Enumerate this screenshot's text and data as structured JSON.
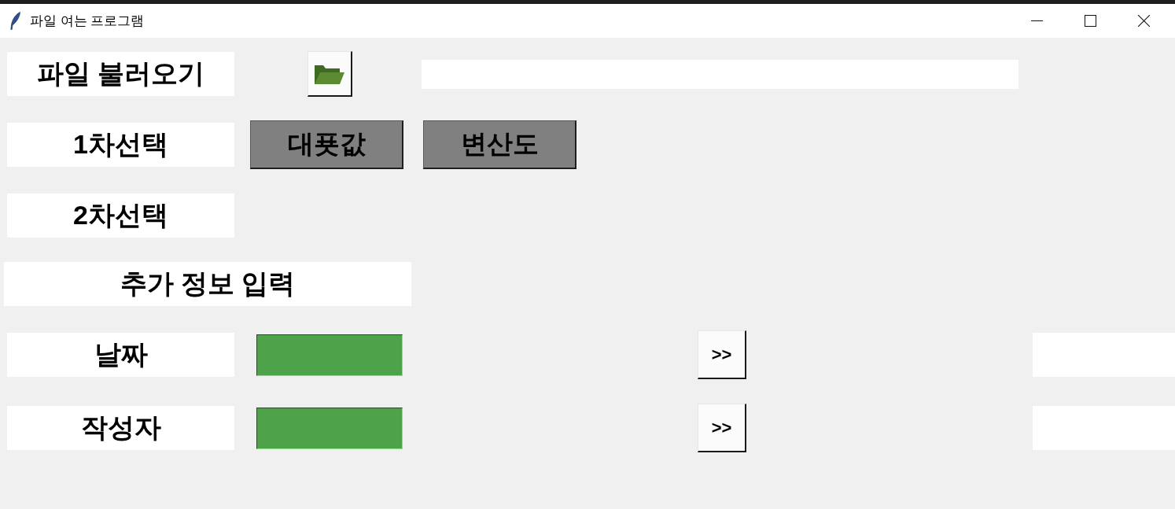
{
  "window": {
    "title": "파일 여는 프로그램"
  },
  "file_row": {
    "label": "파일 불러오기"
  },
  "first_choice": {
    "label": "1차선택",
    "buttons": [
      "대푯값",
      "변산도"
    ]
  },
  "second_choice": {
    "label": "2차선택"
  },
  "extra_info": {
    "title": "추가 정보 입력",
    "fields": [
      {
        "label": "날짜",
        "button": ">>"
      },
      {
        "label": "작성자",
        "button": ">>"
      }
    ]
  }
}
